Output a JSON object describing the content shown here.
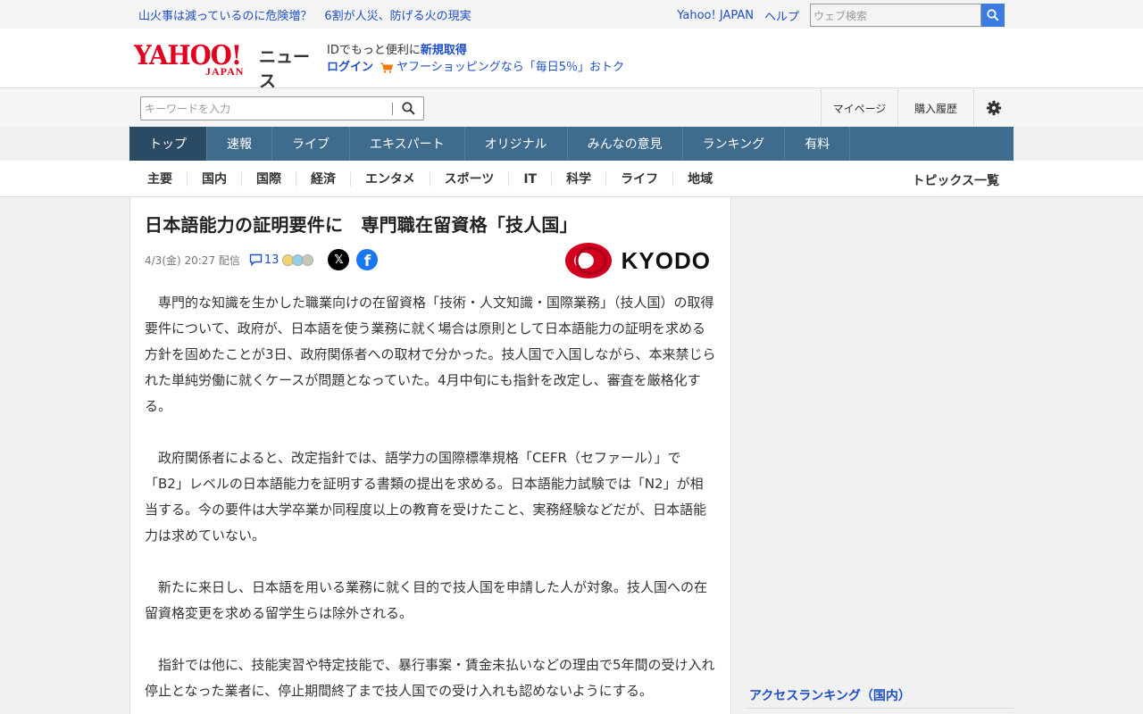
{
  "ticker": {
    "links": [
      "山火事は減っているのに危険増？",
      "6割が人災、防げる火の現実"
    ],
    "right_links": [
      "Yahoo! JAPAN",
      "ヘルプ"
    ],
    "search_placeholder": "ウェブ検索"
  },
  "header": {
    "logo_yahoo": "YAHOO!",
    "logo_japan": "JAPAN",
    "logo_news": "ニュース",
    "id_prefix": "IDでもっと便利に",
    "id_signup": "新規取得",
    "login": "ログイン",
    "shopping_promo": "ヤフーショッピングなら「毎日5％」おトク"
  },
  "search": {
    "placeholder": "キーワードを入力",
    "mypage": "マイページ",
    "purchase_history": "購入履歴"
  },
  "main_nav": [
    "トップ",
    "速報",
    "ライブ",
    "エキスパート",
    "オリジナル",
    "みんなの意見",
    "ランキング",
    "有料"
  ],
  "main_nav_active": 0,
  "sub_nav": [
    "主要",
    "国内",
    "国際",
    "経済",
    "エンタメ",
    "スポーツ",
    "IT",
    "科学",
    "ライフ",
    "地域"
  ],
  "sub_nav_active": 1,
  "topics_list": "トピックス一覧",
  "article": {
    "title": "日本語能力の証明要件に　専門職在留資格「技人国」",
    "date": "4/3(金) 20:27 配信",
    "comment_count": "13",
    "source": "KYODO",
    "paragraphs": [
      "専門的な知識を生かした職業向けの在留資格「技術・人文知識・国際業務」（技人国）の取得要件について、政府が、日本語を使う業務に就く場合は原則として日本語能力の証明を求める方針を固めたことが3日、政府関係者への取材で分かった。技人国で入国しながら、本来禁じられた単純労働に就くケースが問題となっていた。4月中旬にも指針を改定し、審査を厳格化する。",
      "政府関係者によると、改定指針では、語学力の国際標準規格「CEFR（セファール）」で「B2」レベルの日本語能力を証明する書類の提出を求める。日本語能力試験では「N2」が相当する。今の要件は大学卒業か同程度以上の教育を受けたこと、実務経験などだが、日本語能力は求めていない。",
      "新たに来日し、日本語を用いる業務に就く目的で技人国を申請した人が対象。技人国への在留資格変更を求める留学生らは除外される。",
      "指針では他に、技能実習や特定技能で、暴行事案・賃金未払いなどの理由で5年間の受け入れ停止となった業者に、停止期間終了まで技人国での受け入れも認めないようにする。"
    ]
  },
  "sidebar": {
    "ranking_title": "アクセスランキング（国内）"
  },
  "colors": {
    "link": "#1e4fc4",
    "nav_bg": "#3f6b8d",
    "nav_active": "#2b4a63",
    "search_btn": "#3c7be0",
    "yahoo_red": "#e00020",
    "kyodo_red": "#d2001f"
  }
}
